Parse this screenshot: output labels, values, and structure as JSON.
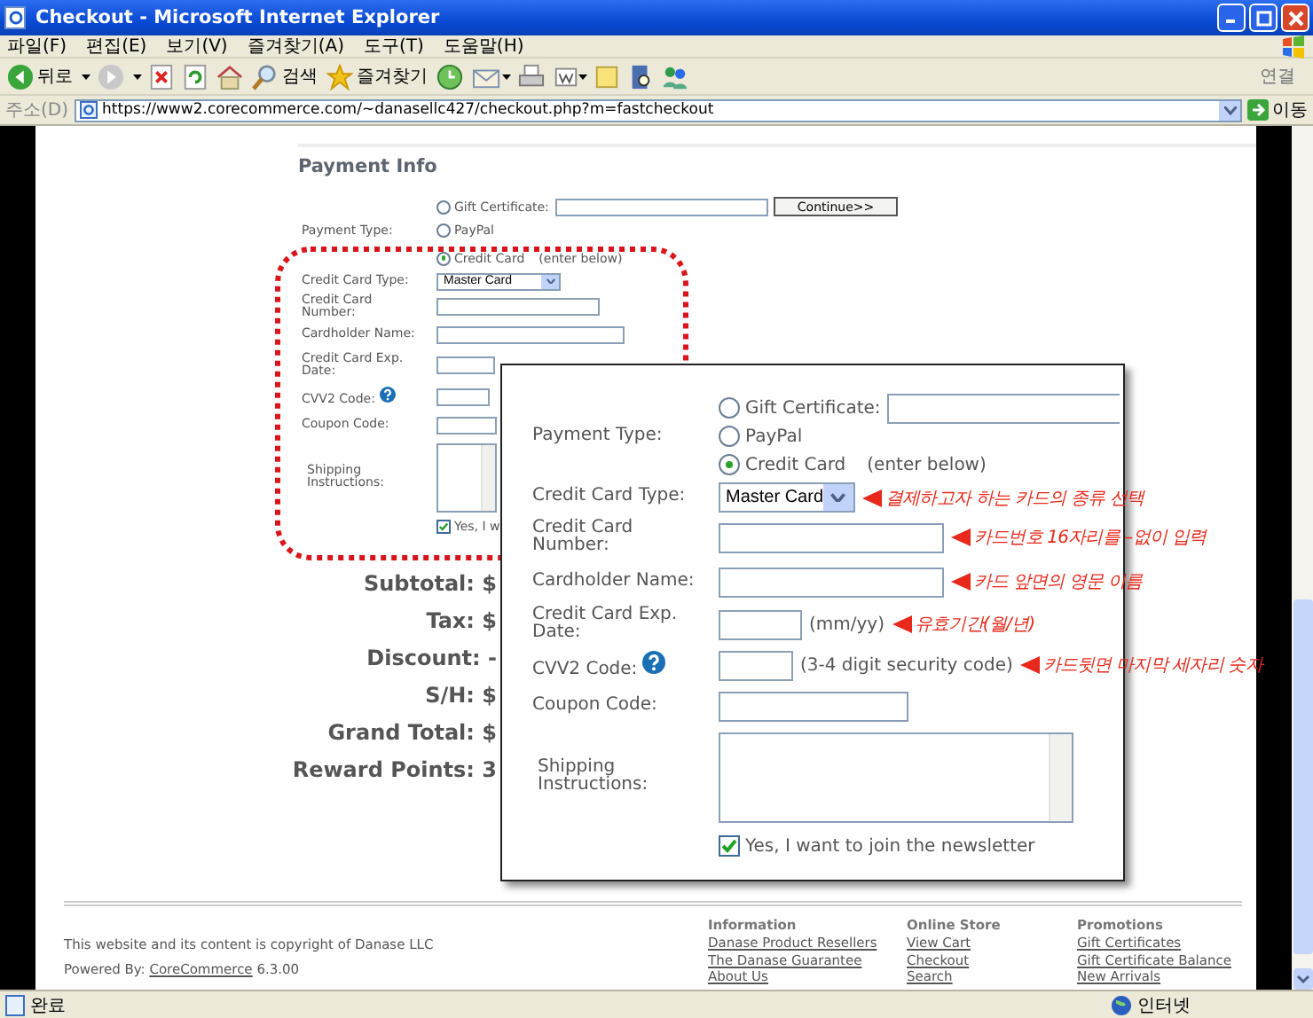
{
  "window": {
    "title": "Checkout - Microsoft Internet Explorer"
  },
  "menu": [
    "파일(F)",
    "편집(E)",
    "보기(V)",
    "즐겨찾기(A)",
    "도구(T)",
    "도움말(H)"
  ],
  "toolbar": {
    "back": "뒤로",
    "search": "검색",
    "favorites": "즐겨찾기",
    "links": "연결"
  },
  "address_bar": {
    "label": "주소(D)",
    "url": "https://www2.corecommerce.com/~danasellc427/checkout.php?m=fastcheckout",
    "go": "이동"
  },
  "page": {
    "heading": "Payment Info",
    "payment_form": {
      "payment_type_label": "Payment Type:",
      "options": [
        {
          "label": "Gift Certificate:",
          "selected": false
        },
        {
          "label": "PayPal",
          "selected": false
        },
        {
          "label": "Credit Card",
          "note": "(enter below)",
          "selected": true
        }
      ],
      "continue_button": "Continue>>",
      "fields": [
        {
          "kind": "select",
          "label": "Credit Card Type:",
          "value": "Master Card"
        },
        {
          "kind": "text",
          "label": "Credit Card Number:"
        },
        {
          "kind": "text",
          "label": "Cardholder Name:"
        },
        {
          "kind": "text",
          "label": "Credit Card Exp. Date:"
        },
        {
          "kind": "text",
          "label": "CVV2 Code:",
          "help": true
        },
        {
          "kind": "text",
          "label": "Coupon Code:"
        },
        {
          "kind": "textarea",
          "label": "Shipping Instructions:"
        }
      ],
      "newsletter": {
        "label": "Yes, I w",
        "checked": true
      }
    },
    "totals": [
      "Subtotal: $",
      "Tax: $",
      "Discount: -",
      "S/H: $",
      "Grand Total: $",
      "Reward Points: 3"
    ],
    "footer": {
      "copyright": "This website and its content is copyright of Danase LLC",
      "powered_by": "Powered By:",
      "powered_link": "CoreCommerce",
      "version": "6.3.00",
      "columns": [
        {
          "heading": "Information",
          "links": [
            "Danase Product Resellers",
            "The Danase Guarantee",
            "About Us"
          ]
        },
        {
          "heading": "Online Store",
          "links": [
            "View Cart",
            "Checkout",
            "Search"
          ]
        },
        {
          "heading": "Promotions",
          "links": [
            "Gift Certificates",
            "Gift Certificate Balance",
            "New Arrivals"
          ]
        }
      ]
    }
  },
  "zoom_panel": {
    "payment_type_label": "Payment Type:",
    "options": [
      {
        "label": "Gift Certificate:",
        "selected": false
      },
      {
        "label": "PayPal",
        "selected": false
      },
      {
        "label": "Credit Card",
        "note": "(enter below)",
        "selected": true
      }
    ],
    "fields": [
      {
        "kind": "select",
        "label": "Credit Card Type:",
        "value": "Master Card",
        "annotation": "결제하고자 하는 카드의 종류 선택"
      },
      {
        "kind": "text",
        "label": "Credit Card Number:",
        "annotation": "카드번호 16자리를 –없이 입력"
      },
      {
        "kind": "text",
        "label": "Cardholder Name:",
        "annotation": "카드 앞면의 영문 이름"
      },
      {
        "kind": "text",
        "label": "Credit Card Exp. Date:",
        "hint": "(mm/yy)",
        "annotation": "유효기간(월/년)"
      },
      {
        "kind": "text",
        "label": "CVV2 Code:",
        "help": true,
        "hint": "(3-4 digit security code)",
        "annotation": "카드뒷면 마지막 세자리 숫자"
      },
      {
        "kind": "text",
        "label": "Coupon Code:"
      },
      {
        "kind": "textarea",
        "label": "Shipping Instructions:"
      }
    ],
    "newsletter": {
      "label": "Yes, I want to join the newsletter",
      "checked": true
    }
  },
  "status_bar": {
    "text": "완료",
    "zone": "인터넷"
  }
}
